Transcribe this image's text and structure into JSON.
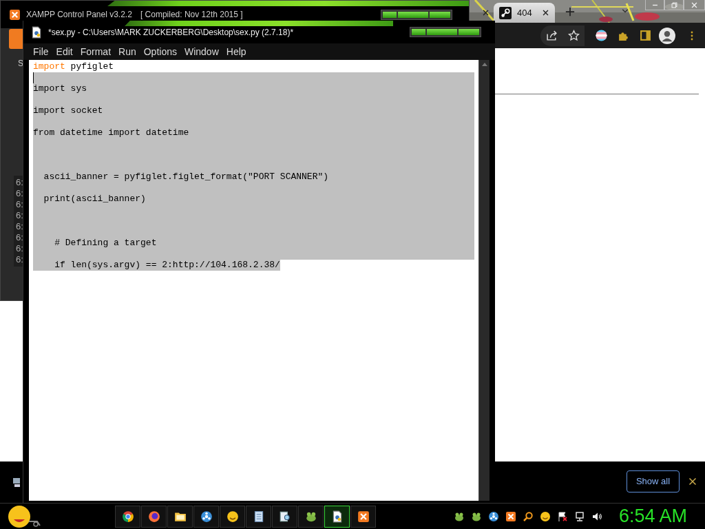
{
  "xampp_window": {
    "title": "XAMPP Control Panel v3.2.2",
    "build": "[ Compiled: Nov 12th 2015 ]",
    "side_label": "S",
    "log_times": [
      "6:",
      "6:",
      "6:",
      "6:",
      "6:",
      "6:",
      "6:",
      "6:"
    ]
  },
  "browser": {
    "tabs": [
      {
        "selected": false
      },
      {
        "label": "404",
        "selected": true
      }
    ],
    "download_bar": {
      "button": "Show all"
    }
  },
  "editor_window": {
    "title": "*sex.py - C:\\Users\\MARK ZUCKERBERG\\Desktop\\sex.py (2.7.18)*",
    "menu": [
      "File",
      "Edit",
      "Format",
      "Run",
      "Options",
      "Window",
      "Help"
    ],
    "lines": [
      {
        "segments": [
          {
            "kind": "keyword",
            "text": "import"
          },
          {
            "kind": "plain",
            "text": " pyfiglet"
          }
        ],
        "selected": false,
        "cursor": false
      },
      {
        "selected": true,
        "cursor": true
      },
      {
        "segments": [
          {
            "text": "import sys"
          }
        ],
        "selected": true,
        "cursor": false
      },
      {
        "selected": true,
        "cursor": false
      },
      {
        "segments": [
          {
            "text": "import socket"
          }
        ],
        "selected": true,
        "cursor": false
      },
      {
        "selected": true,
        "cursor": false
      },
      {
        "segments": [
          {
            "text": "from datetime import datetime"
          }
        ],
        "selected": true,
        "cursor": false
      },
      {
        "selected": true,
        "cursor": false
      },
      {
        "selected": true,
        "cursor": false
      },
      {
        "selected": true,
        "cursor": false
      },
      {
        "segments": [
          {
            "text": "  ascii_banner = pyfiglet.figlet_format(\"PORT SCANNER\")"
          }
        ],
        "selected": true,
        "cursor": false
      },
      {
        "selected": true,
        "cursor": false
      },
      {
        "segments": [
          {
            "text": "  print(ascii_banner)"
          }
        ],
        "selected": true,
        "cursor": false
      },
      {
        "selected": true,
        "cursor": false
      },
      {
        "selected": true,
        "cursor": false
      },
      {
        "selected": true,
        "cursor": false
      },
      {
        "segments": [
          {
            "text": "    # Defining a target"
          }
        ],
        "selected": true,
        "cursor": false
      },
      {
        "selected": true,
        "cursor": false
      },
      {
        "segments": [
          {
            "text": "    if len(sys.argv) == 2:http://104.168.2.38/"
          }
        ],
        "selected": true,
        "cursor": false
      }
    ]
  },
  "taskbar": {
    "apps": [
      {
        "kind": "chrome",
        "selected": false
      },
      {
        "kind": "firefox",
        "selected": false
      },
      {
        "kind": "folder",
        "selected": false
      },
      {
        "kind": "steam",
        "selected": false
      },
      {
        "kind": "emoji",
        "selected": false
      },
      {
        "kind": "notepad",
        "selected": false
      },
      {
        "kind": "tool",
        "selected": false
      },
      {
        "kind": "frog",
        "selected": false
      },
      {
        "kind": "idle",
        "selected": true
      },
      {
        "kind": "xampp",
        "selected": false
      }
    ],
    "tray": [
      {
        "kind": "frog"
      },
      {
        "kind": "frog"
      },
      {
        "kind": "steam"
      },
      {
        "kind": "xampp"
      },
      {
        "kind": "search"
      },
      {
        "kind": "emoji"
      },
      {
        "kind": "flag"
      },
      {
        "kind": "network"
      },
      {
        "kind": "speaker"
      }
    ],
    "clock": "6:54 AM"
  }
}
